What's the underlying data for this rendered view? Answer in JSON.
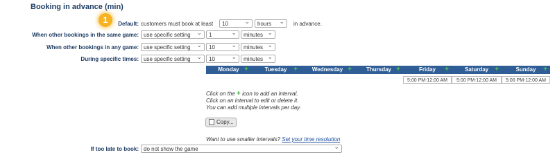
{
  "section_title": "Booking in advance (min)",
  "badge_number": "1",
  "default_row": {
    "label": "Default:",
    "text_before": "customers must book at least",
    "amount": "10",
    "unit": "hours",
    "text_after": "in advance."
  },
  "rows": [
    {
      "label": "When other bookings in the same game:",
      "mode": "use specific setting",
      "amount": "1",
      "unit": "minutes"
    },
    {
      "label": "When other bookings in any game:",
      "mode": "use specific setting",
      "amount": "10",
      "unit": "minutes"
    },
    {
      "label": "During specific times:",
      "mode": "use specific setting",
      "amount": "10",
      "unit": "minutes"
    }
  ],
  "days": [
    "Monday",
    "Tuesday",
    "Wednesday",
    "Thursday",
    "Friday",
    "Saturday",
    "Sunday"
  ],
  "intervals": [
    {
      "day": "Friday",
      "text": "5:00 PM-12:00 AM"
    },
    {
      "day": "Saturday",
      "text": "5:00 PM-12:00 AM"
    },
    {
      "day": "Sunday",
      "text": "5:00 PM-12:00 AM"
    }
  ],
  "hints": {
    "line1_pre": "Click on the",
    "line1_post": "icon to add an interval.",
    "line2": "Click on an interval to edit or delete it.",
    "line3": "You can add multiple intervals per day."
  },
  "copy_label": "Copy...",
  "smaller_prefix": "Want to use smaller intervals?",
  "smaller_link": "Set your time resolution",
  "too_late": {
    "label": "If too late to book:",
    "value": "do not show the game"
  },
  "colors": {
    "header_bg": "#2f5d95",
    "label": "#1d3b63",
    "badge": "#f5b324",
    "plus": "#4ed04e"
  }
}
